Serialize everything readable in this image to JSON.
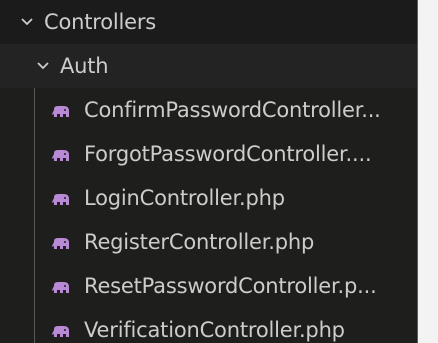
{
  "tree": {
    "root_folder": {
      "label": "Controllers",
      "icon": "chevron-down-icon"
    },
    "sub_folder": {
      "label": "Auth",
      "icon": "chevron-down-icon"
    },
    "files": [
      {
        "label": "ConfirmPasswordController...",
        "icon": "php-elephant-icon"
      },
      {
        "label": "ForgotPasswordController....",
        "icon": "php-elephant-icon"
      },
      {
        "label": "LoginController.php",
        "icon": "php-elephant-icon"
      },
      {
        "label": "RegisterController.php",
        "icon": "php-elephant-icon"
      },
      {
        "label": "ResetPasswordController.p...",
        "icon": "php-elephant-icon"
      },
      {
        "label": "VerificationController.php",
        "icon": "php-elephant-icon"
      }
    ]
  },
  "colors": {
    "background": "#1e1f1c",
    "text": "#cccccc",
    "php_icon": "#b88ad5",
    "guide_line": "#585858"
  }
}
